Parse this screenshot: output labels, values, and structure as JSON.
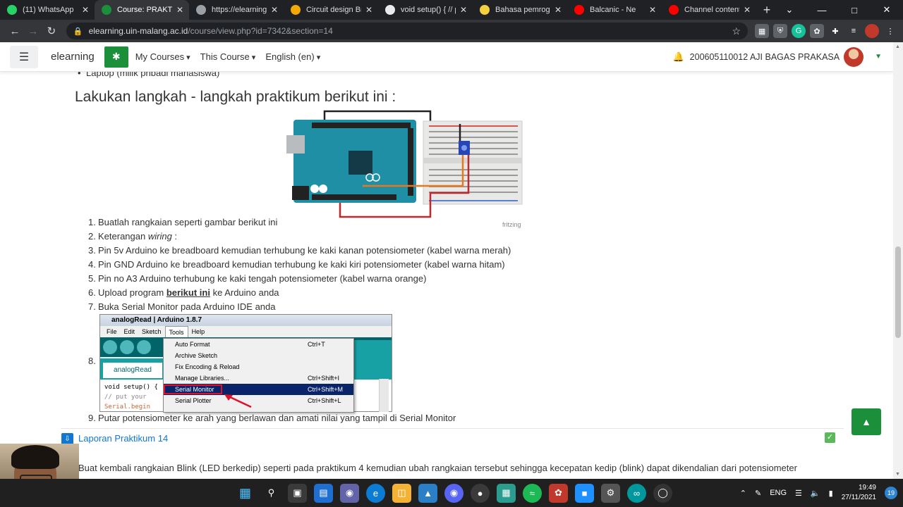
{
  "browser": {
    "tabs": [
      {
        "title": "(11) WhatsApp",
        "color": "#25d366",
        "active": false
      },
      {
        "title": "Course: PRAKTIKU",
        "color": "#1c8f3a",
        "active": true
      },
      {
        "title": "https://elearning.u",
        "color": "#9aa0a6",
        "active": false
      },
      {
        "title": "Circuit design Bra",
        "color": "#f2a900",
        "active": false
      },
      {
        "title": "void setup() { // p",
        "color": "#e8eaed",
        "active": false
      },
      {
        "title": "Bahasa pemrogra",
        "color": "#f4d03f",
        "active": false
      },
      {
        "title": "Balcanic - Ne",
        "color": "#ff0000",
        "active": false
      },
      {
        "title": "Channel content",
        "color": "#ff0000",
        "active": false
      }
    ],
    "url_host": "elearning.uin-malang.ac.id",
    "url_path": "/course/view.php?id=7342&section=14"
  },
  "moodle_nav": {
    "brand": "elearning",
    "menus": [
      "My Courses",
      "This Course",
      "English (en)"
    ],
    "user_name": "200605110012 AJI BAGAS PRAKASA"
  },
  "content": {
    "cutoff_item": "Laptop (milik pribadi mahasiswa)",
    "heading": "Lakukan langkah - langkah praktikum berikut ini :",
    "fritzing_label": "fritzing",
    "steps": [
      {
        "num": "1.",
        "text": "Buatlah rangkaian seperti gambar berikut ini"
      },
      {
        "num": "2.",
        "text_before": "Keterangan ",
        "em": "wiring",
        "text_after": " :"
      },
      {
        "num": "3.",
        "text": "Pin 5v Arduino ke breadboard kemudian terhubung ke kaki kanan potensiometer (kabel warna merah)"
      },
      {
        "num": "4.",
        "text": "Pin GND Arduino ke breadboard kemudian terhubung ke kaki kiri potensiometer (kabel warna hitam)"
      },
      {
        "num": "5.",
        "text": "Pin no A3 Arduino terhubung ke kaki tengah potensiometer (kabel warna orange)"
      },
      {
        "num": "6.",
        "text_before": "Upload program ",
        "link": "berikut ini",
        "text_after": " ke Arduino anda"
      },
      {
        "num": "7.",
        "text": "Buka Serial Monitor pada Arduino IDE anda"
      }
    ],
    "step8_num": "8.",
    "step9": {
      "num": "9.",
      "text": "Putar potensiometer ke arah yang berlawan dan amati nilai yang tampil di Serial Monitor"
    },
    "section_link": "Laporan Praktikum 14",
    "paragraph": "Buat kembali rangkaian Blink (LED berkedip) seperti pada praktikum 4 kemudian ubah rangkaian tersebut sehingga kecepatan kedip (blink) dapat dikendalian dari potensiometer"
  },
  "ide": {
    "title": "analogRead | Arduino 1.8.7",
    "menu": [
      "File",
      "Edit",
      "Sketch",
      "Tools",
      "Help"
    ],
    "tab": "analogRead",
    "code": [
      "void setup() {",
      "  // put your",
      "  Serial.begin"
    ],
    "dropdown": [
      {
        "label": "Auto Format",
        "shortcut": "Ctrl+T"
      },
      {
        "label": "Archive Sketch",
        "shortcut": ""
      },
      {
        "label": "Fix Encoding & Reload",
        "shortcut": ""
      },
      {
        "label": "Manage Libraries...",
        "shortcut": "Ctrl+Shift+I"
      },
      {
        "label": "Serial Monitor",
        "shortcut": "Ctrl+Shift+M",
        "selected": true
      },
      {
        "label": "Serial Plotter",
        "shortcut": "Ctrl+Shift+L"
      }
    ]
  },
  "taskbar": {
    "lang": "ENG",
    "time": "19:49",
    "date": "27/11/2021",
    "notifications": "19"
  }
}
